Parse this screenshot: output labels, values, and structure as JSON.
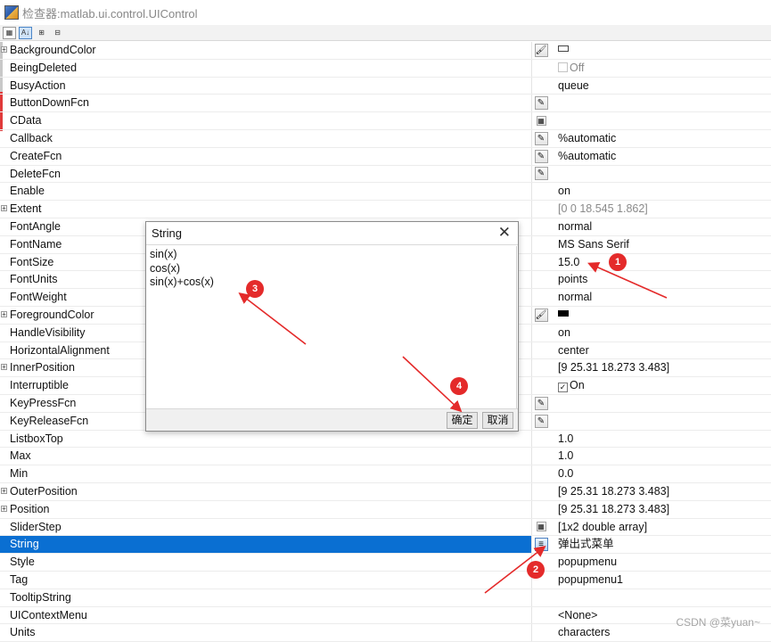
{
  "window": {
    "title": "检查器:matlab.ui.control.UIControl"
  },
  "toolbar": {
    "icons": [
      "categorize-icon",
      "sort-alpha-icon",
      "expand-all-icon",
      "collapse-all-icon"
    ]
  },
  "properties": [
    {
      "name": "BackgroundColor",
      "expandable": true,
      "button": "paint-bucket",
      "value": "",
      "value_type": "swatch-white"
    },
    {
      "name": "BeingDeleted",
      "button": "",
      "value": "Off",
      "value_type": "checkbox-dim"
    },
    {
      "name": "BusyAction",
      "button": "",
      "value": "queue"
    },
    {
      "name": "ButtonDownFcn",
      "button": "pencil",
      "value": ""
    },
    {
      "name": "CData",
      "button": "grid",
      "value": ""
    },
    {
      "name": "Callback",
      "button": "pencil",
      "value": "%automatic"
    },
    {
      "name": "CreateFcn",
      "button": "pencil",
      "value": "%automatic"
    },
    {
      "name": "DeleteFcn",
      "button": "pencil",
      "value": ""
    },
    {
      "name": "Enable",
      "button": "",
      "value": "on"
    },
    {
      "name": "Extent",
      "expandable": true,
      "button": "",
      "value": "[0 0 18.545 1.862]",
      "value_type": "gray"
    },
    {
      "name": "FontAngle",
      "button": "",
      "value": "normal"
    },
    {
      "name": "FontName",
      "button": "",
      "value": "MS Sans Serif"
    },
    {
      "name": "FontSize",
      "button": "",
      "value": "15.0"
    },
    {
      "name": "FontUnits",
      "button": "",
      "value": "points"
    },
    {
      "name": "FontWeight",
      "button": "",
      "value": "normal"
    },
    {
      "name": "ForegroundColor",
      "expandable": true,
      "button": "paint-bucket",
      "value": "",
      "value_type": "swatch-black"
    },
    {
      "name": "HandleVisibility",
      "button": "",
      "value": "on"
    },
    {
      "name": "HorizontalAlignment",
      "button": "",
      "value": "center"
    },
    {
      "name": "InnerPosition",
      "expandable": true,
      "button": "",
      "value": "[9 25.31 18.273 3.483]"
    },
    {
      "name": "Interruptible",
      "button": "",
      "value": "On",
      "value_type": "checkbox-checked"
    },
    {
      "name": "KeyPressFcn",
      "button": "pencil",
      "value": ""
    },
    {
      "name": "KeyReleaseFcn",
      "button": "pencil",
      "value": ""
    },
    {
      "name": "ListboxTop",
      "button": "",
      "value": "1.0"
    },
    {
      "name": "Max",
      "button": "",
      "value": "1.0"
    },
    {
      "name": "Min",
      "button": "",
      "value": "0.0"
    },
    {
      "name": "OuterPosition",
      "expandable": true,
      "button": "",
      "value": "[9 25.31 18.273 3.483]"
    },
    {
      "name": "Position",
      "expandable": true,
      "button": "",
      "value": "[9 25.31 18.273 3.483]"
    },
    {
      "name": "SliderStep",
      "button": "grid",
      "value": "[1x2  double array]"
    },
    {
      "name": "String",
      "button": "list",
      "value": "弹出式菜单",
      "selected": true
    },
    {
      "name": "Style",
      "button": "",
      "value": "popupmenu"
    },
    {
      "name": "Tag",
      "button": "",
      "value": "popupmenu1"
    },
    {
      "name": "TooltipString",
      "button": "",
      "value": ""
    },
    {
      "name": "UIContextMenu",
      "button": "",
      "value": "<None>"
    },
    {
      "name": "Units",
      "button": "",
      "value": "characters"
    }
  ],
  "dialog": {
    "title": "String",
    "text": "sin(x)\ncos(x)\nsin(x)+cos(x)",
    "ok_label": "确定",
    "cancel_label": "取消",
    "close_icon": "close-icon"
  },
  "annotations": [
    {
      "label": "1"
    },
    {
      "label": "2"
    },
    {
      "label": "3"
    },
    {
      "label": "4"
    }
  ],
  "annotation_color": "#e42a2a",
  "selection_color": "#0a6fd2",
  "watermark": "CSDN @菜yuan~"
}
